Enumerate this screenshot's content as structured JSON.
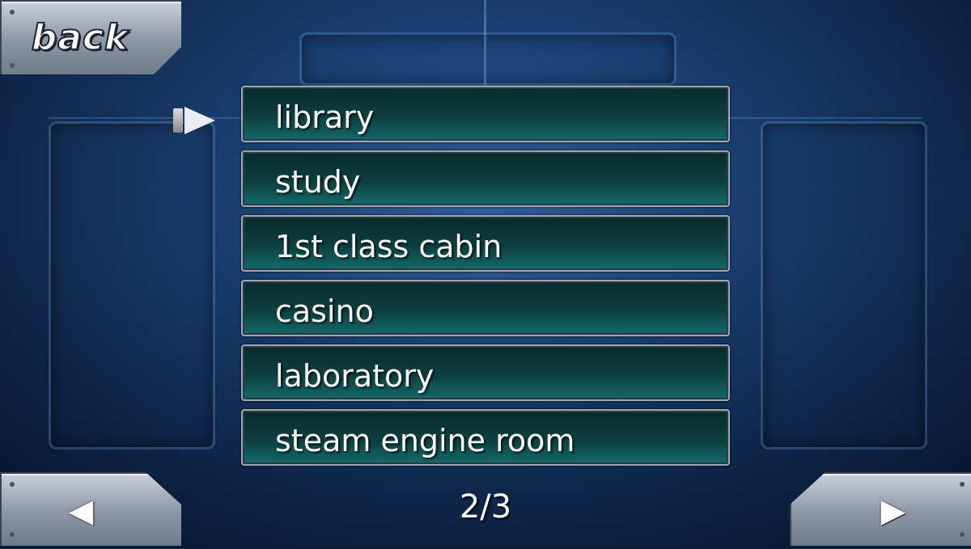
{
  "back_button": {
    "label": "back"
  },
  "menu": {
    "items": [
      {
        "label": "library",
        "selected": true
      },
      {
        "label": "study",
        "selected": false
      },
      {
        "label": "1st class cabin",
        "selected": false
      },
      {
        "label": "casino",
        "selected": false
      },
      {
        "label": "laboratory",
        "selected": false
      },
      {
        "label": "steam engine room",
        "selected": false
      }
    ]
  },
  "pagination": {
    "indicator": "2/3",
    "prev_icon": "left-triangle-icon",
    "next_icon": "right-triangle-icon"
  },
  "colors": {
    "menu_item_bg": "#0c3f40",
    "menu_item_border": "#9aa7b5",
    "button_metal": "#8e99a8",
    "background": "#17365f"
  }
}
